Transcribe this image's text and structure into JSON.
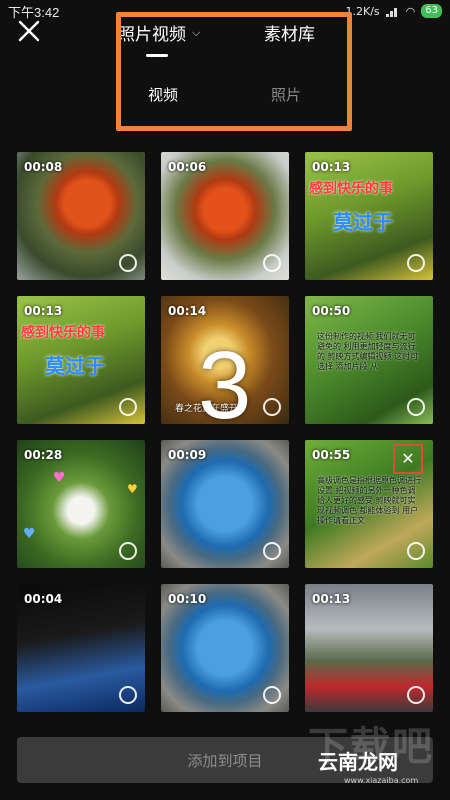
{
  "status": {
    "time": "下午3:42",
    "speed": "1.2K/s",
    "battery": "63"
  },
  "header": {
    "tab_photos_videos": "照片视频",
    "tab_library": "素材库"
  },
  "subtabs": {
    "video": "视频",
    "photo": "照片"
  },
  "big_number": "3",
  "tiles": [
    {
      "duration": "00:08"
    },
    {
      "duration": "00:06"
    },
    {
      "duration": "00:13",
      "caption1": "感到快乐的事",
      "caption2": "莫过于"
    },
    {
      "duration": "00:13",
      "caption1": "感到快乐的事",
      "caption2": "莫过于"
    },
    {
      "duration": "00:14",
      "caption_bottom": "春之花正在盛开"
    },
    {
      "duration": "00:50",
      "overlay_text": "这份制作的视频 我们就无可避免的 利用更加轻度与流行的 剪映方式编辑视频 这时可选择 添加片段 从"
    },
    {
      "duration": "00:28"
    },
    {
      "duration": "00:09"
    },
    {
      "duration": "00:55",
      "overlay_text": "高级调色是指根据原色调进行设置 把视频的另外一种色调 给人更好的感受 剪映就可实现视频调色 都能体验到 用户操作请看正文"
    },
    {
      "duration": "00:04"
    },
    {
      "duration": "00:10"
    },
    {
      "duration": "00:13"
    }
  ],
  "bottom_button": "添加到项目",
  "watermark": {
    "big": "下载吧",
    "main": "云南龙网",
    "url": "www.xiazaiba.com"
  }
}
